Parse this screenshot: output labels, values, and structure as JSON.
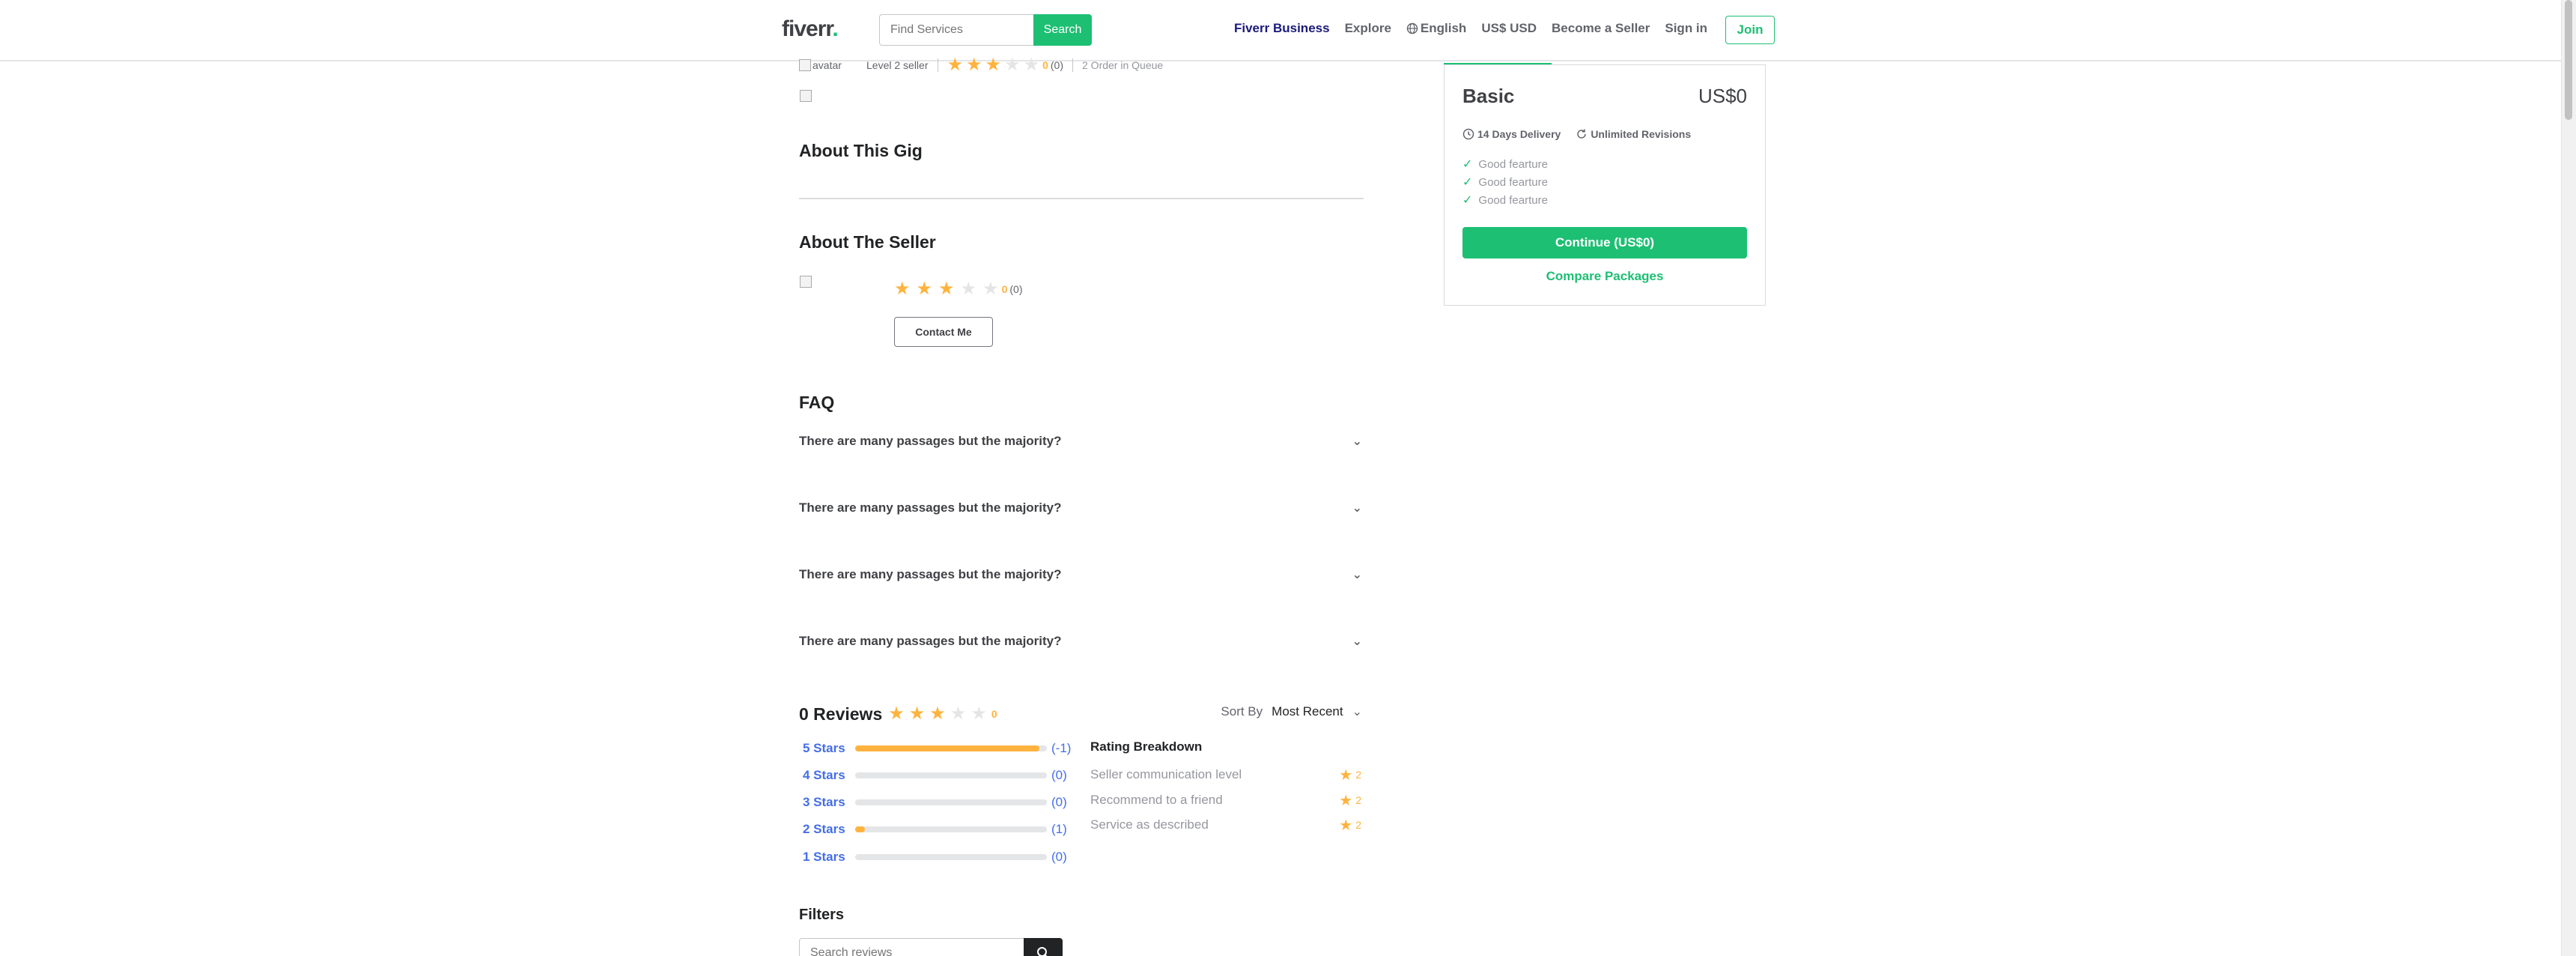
{
  "header": {
    "logo": "fiverr",
    "logo_dot": ".",
    "search_placeholder": "Find Services",
    "search_button": "Search",
    "nav": {
      "business": "Fiverr Business",
      "explore": "Explore",
      "language": "English",
      "currency": "US$ USD",
      "become_seller": "Become a Seller",
      "sign_in": "Sign in",
      "join": "Join"
    }
  },
  "seller_top": {
    "avatar_alt": "avatar",
    "level": "Level 2 seller",
    "rating_value": "0",
    "rating_count": "(0)",
    "stars_filled": 3,
    "stars_total": 5,
    "queue": "2 Order in Queue"
  },
  "sections": {
    "about_gig": "About This Gig",
    "about_seller": "About The Seller"
  },
  "about_seller": {
    "image_alt": "",
    "rating_value": "0",
    "rating_count": "(0)",
    "contact_button": "Contact Me"
  },
  "faq": {
    "title": "FAQ",
    "items": [
      "There are many passages but the majority?",
      "There are many passages but the majority?",
      "There are many passages but the majority?",
      "There are many passages but the majority?"
    ]
  },
  "reviews": {
    "title": "0 Reviews",
    "rating_value": "0",
    "sort_label": "Sort By",
    "sort_value": "Most Recent",
    "star_rows": [
      {
        "label": "5 Stars",
        "count": "(-1)",
        "fill": 0.96
      },
      {
        "label": "4 Stars",
        "count": "(0)",
        "fill": 0
      },
      {
        "label": "3 Stars",
        "count": "(0)",
        "fill": 0
      },
      {
        "label": "2 Stars",
        "count": "(1)",
        "fill": 0.05
      },
      {
        "label": "1 Stars",
        "count": "(0)",
        "fill": 0
      }
    ],
    "breakdown_title": "Rating Breakdown",
    "breakdown": [
      {
        "label": "Seller communication level",
        "value": "2"
      },
      {
        "label": "Recommend to a friend",
        "value": "2"
      },
      {
        "label": "Service as described",
        "value": "2"
      }
    ]
  },
  "filters": {
    "title": "Filters",
    "search_placeholder": "Search reviews"
  },
  "package": {
    "name": "Basic",
    "price": "US$0",
    "delivery": "14 Days Delivery",
    "revisions": "Unlimited Revisions",
    "features": [
      "Good fearture",
      "Good fearture",
      "Good fearture"
    ],
    "continue": "Continue (US$0)",
    "compare": "Compare Packages"
  },
  "colors": {
    "brand": "#1dbf73",
    "star": "#ffb33e",
    "link": "#446ee7"
  }
}
